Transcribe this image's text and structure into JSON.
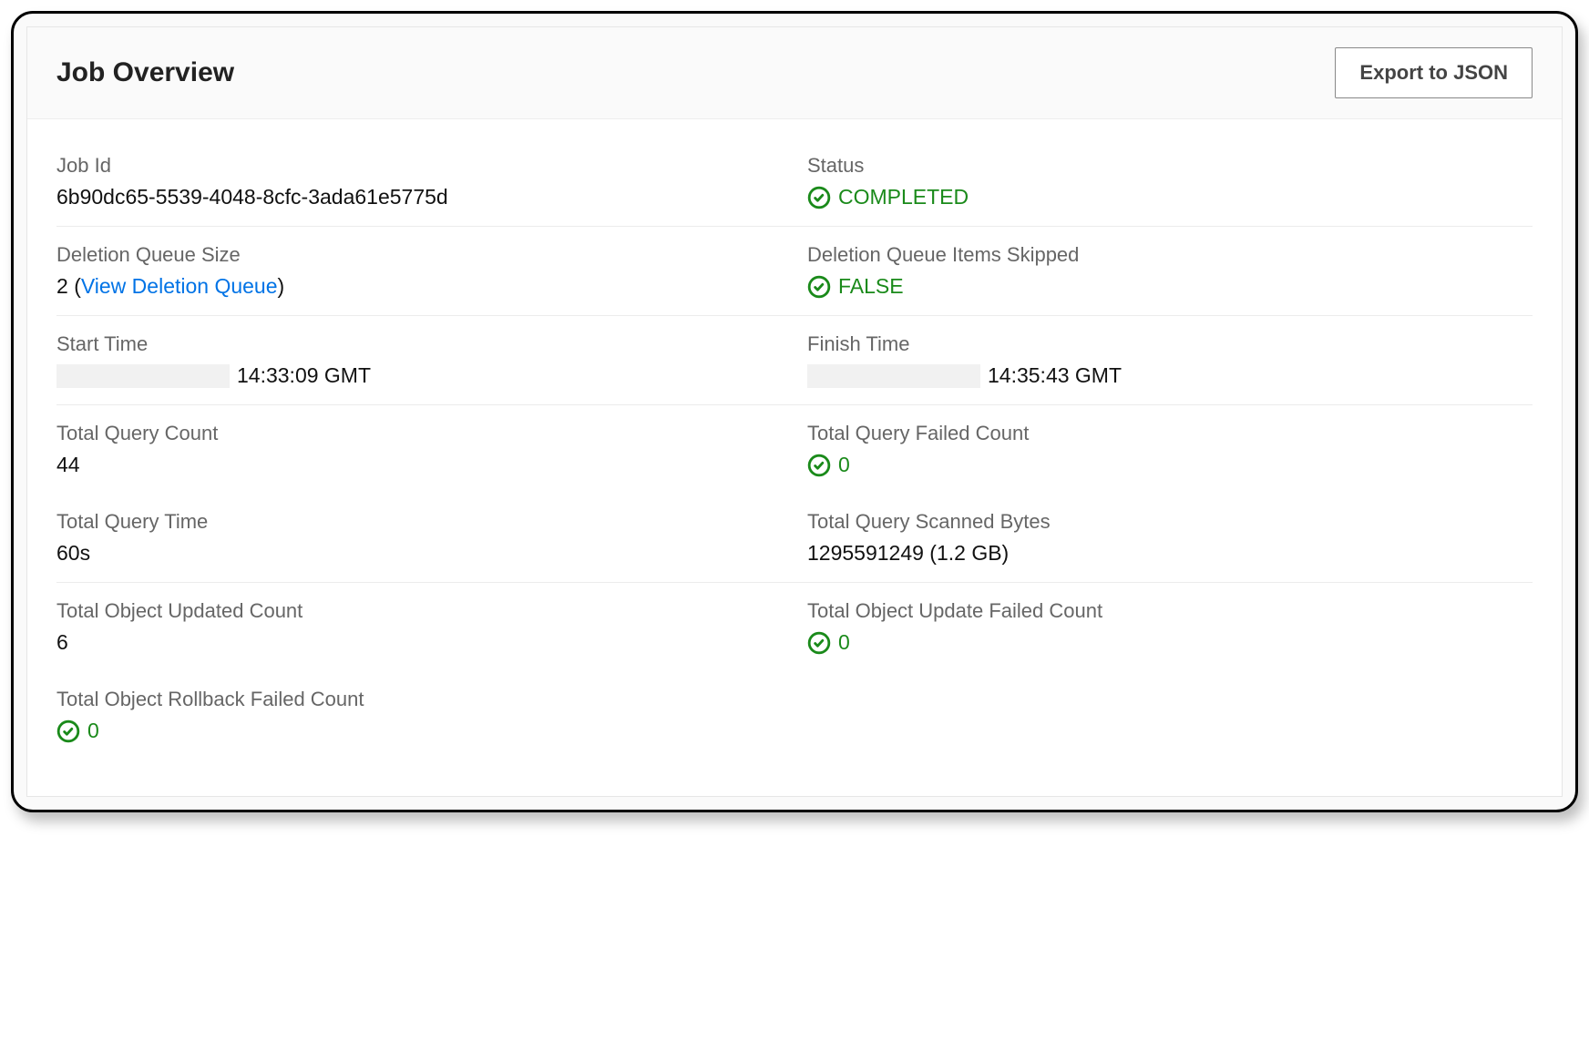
{
  "header": {
    "title": "Job Overview",
    "export_label": "Export to JSON"
  },
  "fields": {
    "job_id": {
      "label": "Job Id",
      "value": "6b90dc65-5539-4048-8cfc-3ada61e5775d"
    },
    "status": {
      "label": "Status",
      "value": "COMPLETED"
    },
    "deletion_queue_size": {
      "label": "Deletion Queue Size",
      "count": "2",
      "link_label": "View Deletion Queue"
    },
    "deletion_queue_skipped": {
      "label": "Deletion Queue Items Skipped",
      "value": "FALSE"
    },
    "start_time": {
      "label": "Start Time",
      "value": "14:33:09 GMT"
    },
    "finish_time": {
      "label": "Finish Time",
      "value": "14:35:43 GMT"
    },
    "total_query_count": {
      "label": "Total Query Count",
      "value": "44"
    },
    "total_query_failed": {
      "label": "Total Query Failed Count",
      "value": "0"
    },
    "total_query_time": {
      "label": "Total Query Time",
      "value": "60s"
    },
    "total_scanned_bytes": {
      "label": "Total Query Scanned Bytes",
      "value": "1295591249 (1.2 GB)"
    },
    "total_object_updated": {
      "label": "Total Object Updated Count",
      "value": "6"
    },
    "total_object_update_failed": {
      "label": "Total Object Update Failed Count",
      "value": "0"
    },
    "total_rollback_failed": {
      "label": "Total Object Rollback Failed Count",
      "value": "0"
    }
  }
}
